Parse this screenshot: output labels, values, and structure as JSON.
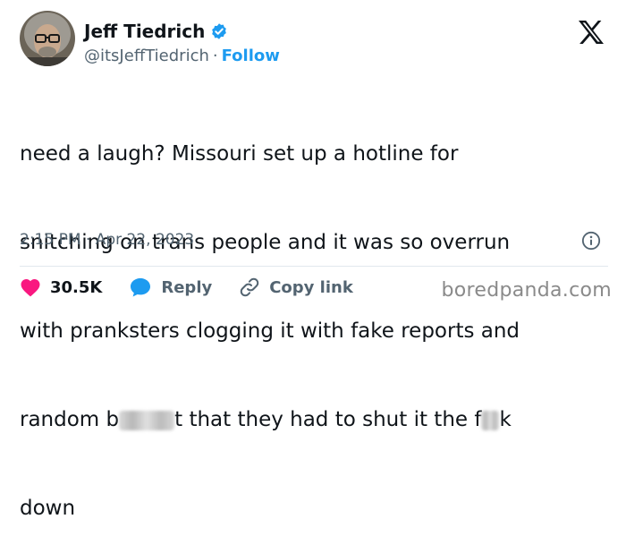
{
  "author": {
    "name": "Jeff Tiedrich",
    "handle": "@itsJeffTiedrich",
    "separator": "·",
    "follow_label": "Follow",
    "verified": true
  },
  "tweet": {
    "line1": "need a laugh? Missouri set up a hotline for",
    "line2": "snitching on trans people and it was so overrun",
    "line3": "with pranksters clogging it with fake reports and",
    "line4_a": "random b",
    "line4_b": "t that they had to shut it the f",
    "line4_c": "k",
    "line5": "down"
  },
  "meta": {
    "time": "2:15 PM",
    "separator": "·",
    "date": "Apr 22, 2023"
  },
  "actions": {
    "likes": "30.5K",
    "reply_label": "Reply",
    "copy_label": "Copy link"
  },
  "watermark": "boredpanda.com",
  "colors": {
    "accent": "#1d9bf0",
    "like": "#f91880",
    "text": "#0f1419",
    "muted": "#536471"
  },
  "icons": [
    "verified-badge-icon",
    "x-logo-icon",
    "info-icon",
    "heart-icon",
    "reply-bubble-icon",
    "link-icon"
  ]
}
